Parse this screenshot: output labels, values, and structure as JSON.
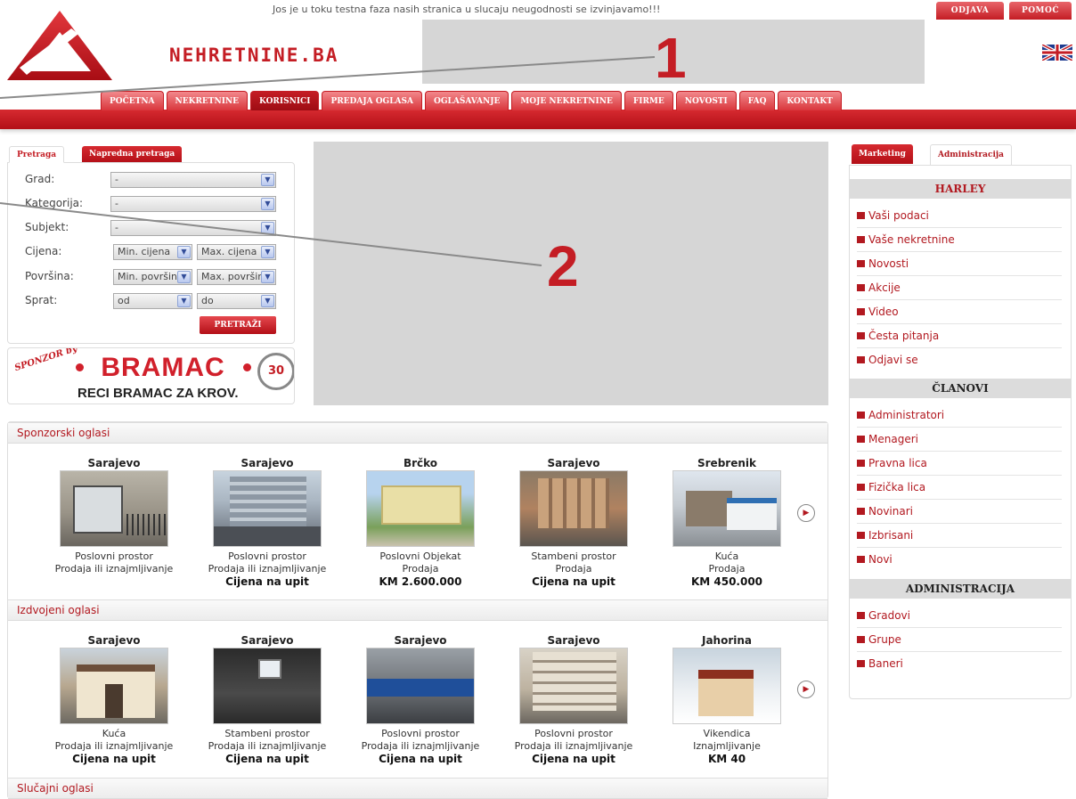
{
  "notice": "Jos je u toku testna faza nasih stranica u slucaju neugodnosti se izvinjavamo!!!",
  "top_buttons": {
    "logout": "ODJAVA",
    "help": "POMOĆ"
  },
  "logo": {
    "text": "NEHRETNINE.BA"
  },
  "nav": [
    "POČETNA",
    "NEKRETNINE",
    "KORISNICI",
    "PREDAJA OGLASA",
    "OGLAŠAVANJE",
    "MOJE NEKRETNINE",
    "FIRME",
    "NOVOSTI",
    "FAQ",
    "KONTAKT"
  ],
  "nav_active": "KORISNICI",
  "search": {
    "tab_basic": "Pretraga",
    "tab_advanced": "Napredna pretraga",
    "fields": {
      "city_label": "Grad:",
      "city_value": "-",
      "category_label": "Kategorija:",
      "category_value": "-",
      "subject_label": "Subjekt:",
      "subject_value": "-",
      "price_label": "Cijena:",
      "price_min": "Min. cijena",
      "price_max": "Max. cijena",
      "area_label": "Površina:",
      "area_min": "Min. površina",
      "area_max": "Max. površina",
      "floor_label": "Sprat:",
      "floor_from": "od",
      "floor_to": "do"
    },
    "button": "PRETRAŽI"
  },
  "sponsor": {
    "by": "SPONZOR by",
    "brand": "BRAMAC",
    "slogan": "RECI BRAMAC ZA KROV.",
    "badge": "30"
  },
  "sections": {
    "sponsored": "Sponzorski oglasi",
    "featured": "Izdvojeni oglasi",
    "random": "Slučajni oglasi"
  },
  "sponsored_listings": [
    {
      "city": "Sarajevo",
      "type": "Poslovni prostor",
      "deal": "Prodaja ili iznajmljivanje",
      "price": ""
    },
    {
      "city": "Sarajevo",
      "type": "Poslovni prostor",
      "deal": "Prodaja ili iznajmljivanje",
      "price": "Cijena na upit"
    },
    {
      "city": "Brčko",
      "type": "Poslovni Objekat",
      "deal": "Prodaja",
      "price": "KM 2.600.000"
    },
    {
      "city": "Sarajevo",
      "type": "Stambeni prostor",
      "deal": "Prodaja",
      "price": "Cijena na upit"
    },
    {
      "city": "Srebrenik",
      "type": "Kuća",
      "deal": "Prodaja",
      "price": "KM 450.000"
    }
  ],
  "featured_listings": [
    {
      "city": "Sarajevo",
      "type": "Kuća",
      "deal": "Prodaja ili iznajmljivanje",
      "price": "Cijena na upit"
    },
    {
      "city": "Sarajevo",
      "type": "Stambeni prostor",
      "deal": "Prodaja ili iznajmljivanje",
      "price": "Cijena na upit"
    },
    {
      "city": "Sarajevo",
      "type": "Poslovni prostor",
      "deal": "Prodaja ili iznajmljivanje",
      "price": "Cijena na upit"
    },
    {
      "city": "Sarajevo",
      "type": "Poslovni prostor",
      "deal": "Prodaja ili iznajmljivanje",
      "price": "Cijena na upit"
    },
    {
      "city": "Jahorina",
      "type": "Vikendica",
      "deal": "Iznajmljivanje",
      "price": "KM 40"
    }
  ],
  "right_panel": {
    "tab_marketing": "Marketing",
    "tab_admin": "Administracija",
    "user_heading": "HARLEY",
    "user_links": [
      "Vaši podaci",
      "Vaše nekretnine",
      "Novosti",
      "Akcije",
      "Video",
      "Česta pitanja",
      "Odjavi se"
    ],
    "members_heading": "ČLANOVI",
    "members_links": [
      "Administratori",
      "Menageri",
      "Pravna lica",
      "Fizička lica",
      "Novinari",
      "Izbrisani",
      "Novi"
    ],
    "admin_heading": "ADMINISTRACIJA",
    "admin_links": [
      "Gradovi",
      "Grupe",
      "Baneri"
    ]
  },
  "annotations": [
    "1",
    "2"
  ],
  "colors": {
    "brand_red": "#c41d24",
    "banner_gray": "#d6d6d6"
  },
  "icons": {
    "bullet": "square-bullet-icon",
    "next": "next-arrow-icon",
    "flag": "uk-flag-icon"
  }
}
